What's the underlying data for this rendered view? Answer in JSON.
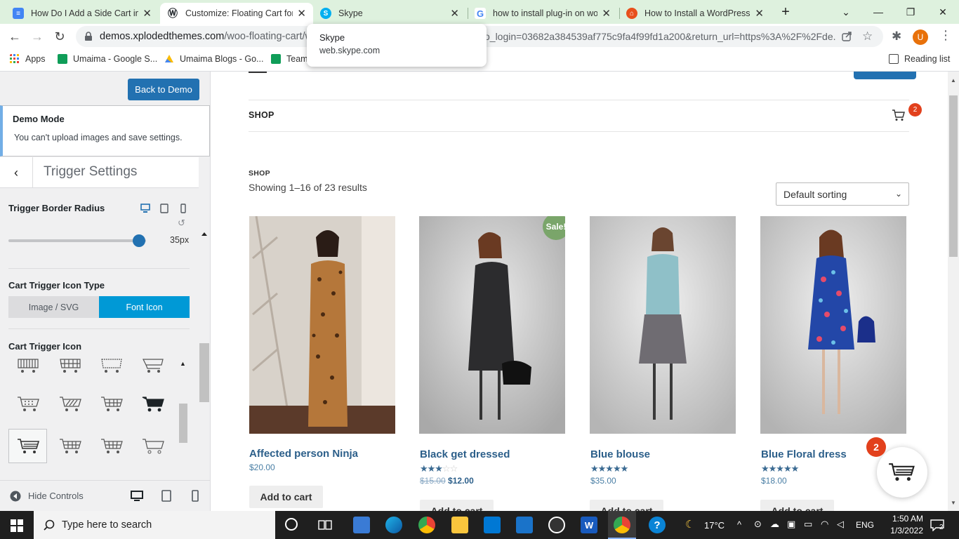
{
  "browser": {
    "tabs": [
      {
        "title": "How Do I Add a Side Cart in W",
        "active": false,
        "icon_color": "#4285f4"
      },
      {
        "title": "Customize: Floating Cart for W",
        "active": true,
        "icon_color": "#23282d"
      },
      {
        "title": "Skype",
        "active": false,
        "icon_color": "#00aff0"
      },
      {
        "title": "how to install plug-in on wor",
        "active": false,
        "icon_color": "#4285f4"
      },
      {
        "title": "How to Install a WordPress P",
        "active": false,
        "icon_color": "#e8501c"
      }
    ],
    "url_host": "demos.xplodedthemes.com",
    "url_path": "/woo-floating-cart/w",
    "url_tail": "o_login=03682a384539af775c9fa4f99fd1a200&return_url=https%3A%2F%2Fde...",
    "profile_initial": "U",
    "bookmarks": [
      "Apps",
      "Umaima - Google S...",
      "Umaima Blogs - Go...",
      "Team"
    ],
    "reading_list": "Reading list",
    "tooltip": {
      "title": "Skype",
      "url": "web.skype.com"
    }
  },
  "panel": {
    "back_to_demo": "Back to Demo",
    "demo_mode_title": "Demo Mode",
    "demo_mode_text": "You can't upload images and save settings.",
    "section_title": "Trigger Settings",
    "border_radius_label": "Trigger Border Radius",
    "border_radius_value": "35px",
    "border_radius_fraction": 0.95,
    "icon_type_label": "Cart Trigger Icon Type",
    "icon_type_options": [
      "Image / SVG",
      "Font Icon"
    ],
    "icon_type_selected": "Font Icon",
    "icon_label": "Cart Trigger Icon",
    "hide_controls": "Hide Controls"
  },
  "preview": {
    "nav_shop": "SHOP",
    "cart_count": "2",
    "breadcrumb": "SHOP",
    "showing": "Showing 1–16 of 23 results",
    "sorting": "Default sorting",
    "products": [
      {
        "name": "Affected person Ninja",
        "price": "$20.00",
        "old_price": "",
        "rating": 0,
        "sale": false,
        "add_label": "Add to cart"
      },
      {
        "name": "Black get dressed",
        "price": "$12.00",
        "old_price": "$15.00",
        "rating": 3,
        "sale": true,
        "sale_label": "Sale!",
        "add_label": "Add to cart"
      },
      {
        "name": "Blue blouse",
        "price": "$35.00",
        "old_price": "",
        "rating": 5,
        "sale": false,
        "add_label": "Add to cart"
      },
      {
        "name": "Blue Floral dress",
        "price": "$18.00",
        "old_price": "",
        "rating": 5,
        "sale": false,
        "add_label": "Add to cart"
      }
    ],
    "floating_cart_count": "2"
  },
  "taskbar": {
    "search_placeholder": "Type here to search",
    "temperature": "17°C",
    "language": "ENG",
    "time": "1:50 AM",
    "date": "1/3/2022",
    "notifications": "2"
  },
  "colors": {
    "accent": "#2271b1",
    "font_icon_active": "#0099d6",
    "badge": "#e2401c",
    "sale": "#7aa56a",
    "product_link": "#2c5f8a"
  }
}
